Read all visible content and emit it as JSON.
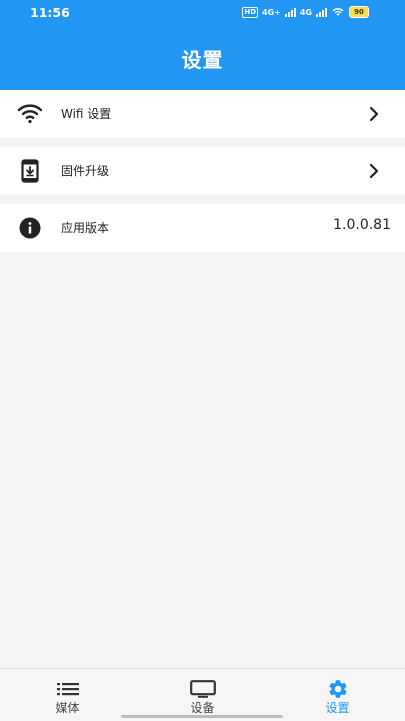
{
  "status": {
    "time": "11:56",
    "hd_label": "HD",
    "net1": "4G+",
    "net2": "4G",
    "battery": "90"
  },
  "header": {
    "title": "设置"
  },
  "settings": {
    "items": [
      {
        "label": "Wifi 设置",
        "icon": "wifi-icon"
      },
      {
        "label": "固件升级",
        "icon": "firmware-update-icon"
      },
      {
        "label": "应用版本",
        "icon": "info-icon",
        "value": "1.0.0.81"
      }
    ]
  },
  "tabbar": {
    "tabs": [
      {
        "label": "媒体",
        "icon": "list-icon"
      },
      {
        "label": "设备",
        "icon": "monitor-icon"
      },
      {
        "label": "设置",
        "icon": "gear-icon",
        "active": true
      }
    ]
  },
  "colors": {
    "accent": "#2196f3",
    "background": "#f4f4f4"
  }
}
